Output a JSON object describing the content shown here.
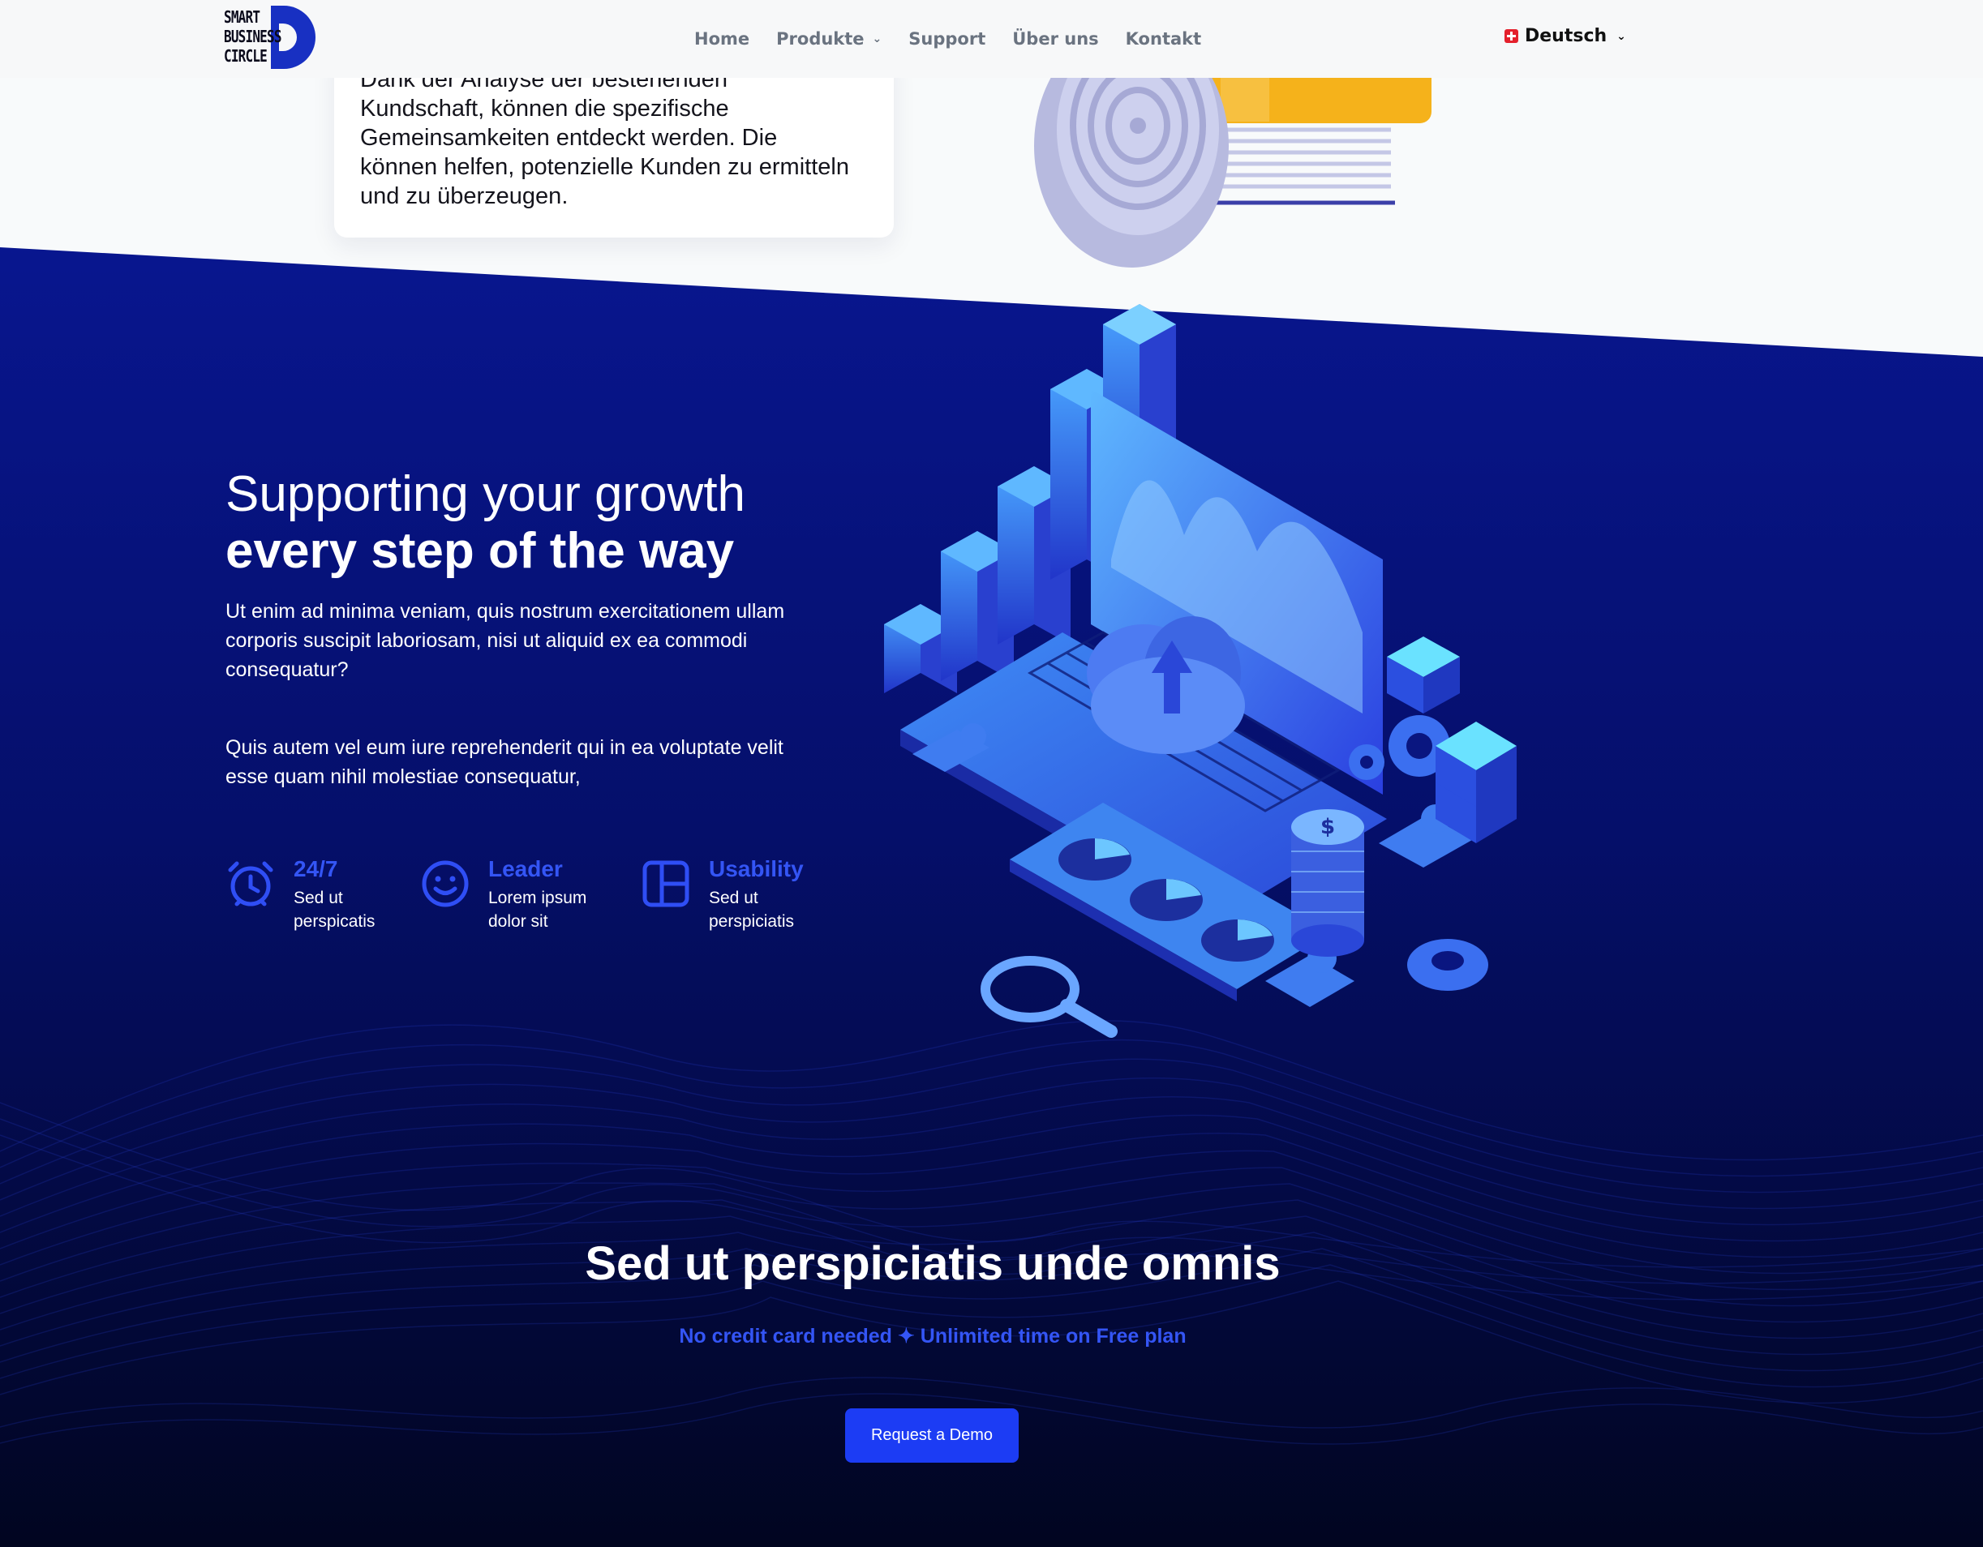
{
  "nav": {
    "logo_lines": [
      "SMART",
      "BUSINESS",
      "CIRCLE"
    ],
    "menu": [
      {
        "label": "Home",
        "has_dropdown": false
      },
      {
        "label": "Produkte",
        "has_dropdown": true
      },
      {
        "label": "Support",
        "has_dropdown": false
      },
      {
        "label": "Über uns",
        "has_dropdown": false
      },
      {
        "label": "Kontakt",
        "has_dropdown": false
      }
    ],
    "language": "Deutsch"
  },
  "top_card": {
    "text": "Dank der Analyse der bestehenden Kundschaft, können die spezifische Gemeinsamkeiten entdeckt werden. Die können helfen, potenzielle Kunden zu ermitteln und zu überzeugen."
  },
  "hero": {
    "title_line1": "Supporting your growth",
    "title_line2": "every step of the way",
    "paragraph1": "Ut enim ad minima veniam, quis nostrum exercitationem ullam corporis suscipit laboriosam, nisi ut aliquid ex ea commodi consequatur?",
    "paragraph2": "Quis autem vel eum iure reprehenderit qui in ea voluptate velit esse quam nihil molestiae consequatur,"
  },
  "features": [
    {
      "icon": "alarm-clock-icon",
      "title": "24/7",
      "line1": "Sed ut",
      "line2": "perspicatis"
    },
    {
      "icon": "smiley-icon",
      "title": "Leader",
      "line1": "Lorem ipsum",
      "line2": "dolor sit"
    },
    {
      "icon": "layout-icon",
      "title": "Usability",
      "line1": "Sed ut",
      "line2": "perspiciatis"
    }
  ],
  "cta": {
    "title": "Sed ut perspiciatis unde omnis",
    "subtitle": "No credit card needed ✦ Unlimited time on Free plan",
    "button": "Request a Demo"
  },
  "colors": {
    "accent": "#1c3cf4",
    "feature_title": "#3455f5",
    "section_top": "#06138a",
    "section_bottom": "#01061f"
  }
}
